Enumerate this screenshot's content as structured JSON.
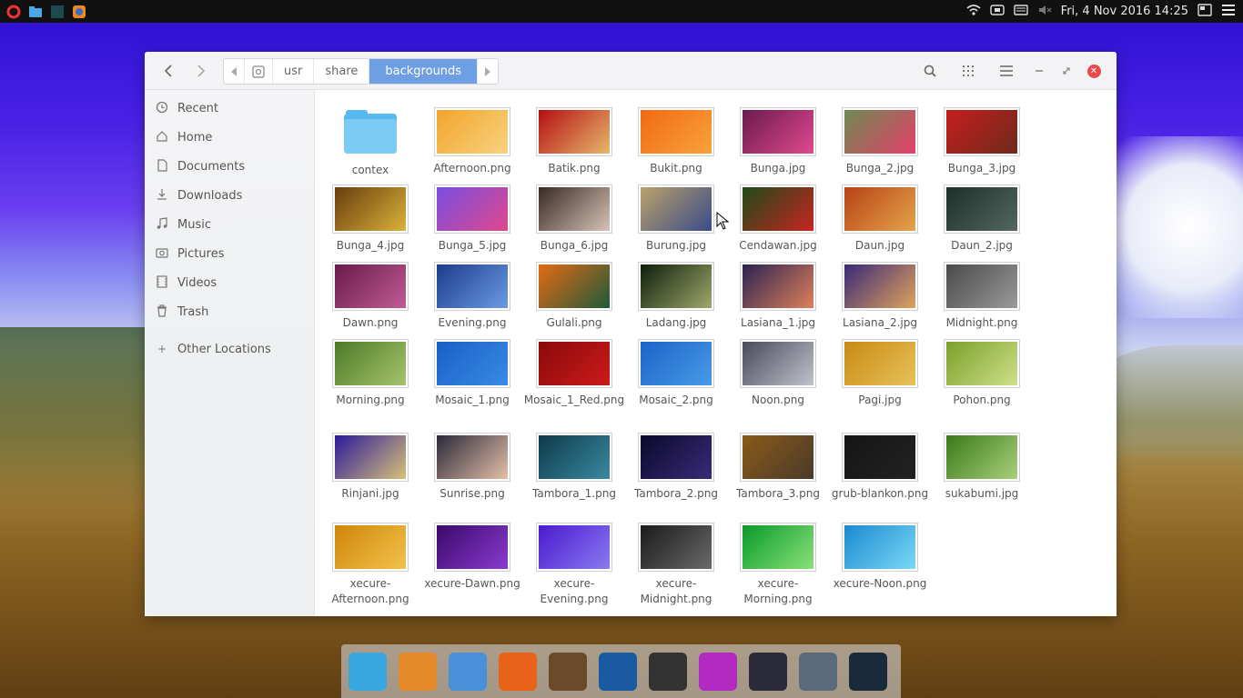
{
  "topbar": {
    "datetime": "Fri, 4 Nov 2016 14:25",
    "left_icons": [
      "opera-icon",
      "files-icon",
      "terminal-icon",
      "firefox-icon"
    ],
    "tray_icons": [
      "wifi-icon",
      "network-icon",
      "keyboard-icon",
      "volume-muted-icon"
    ]
  },
  "header": {
    "path": [
      "usr",
      "share",
      "backgrounds"
    ],
    "active_path": "backgrounds"
  },
  "sidebar": {
    "items": [
      {
        "label": "Recent",
        "icon": "clock-icon"
      },
      {
        "label": "Home",
        "icon": "home-icon"
      },
      {
        "label": "Documents",
        "icon": "document-icon"
      },
      {
        "label": "Downloads",
        "icon": "download-icon"
      },
      {
        "label": "Music",
        "icon": "music-icon"
      },
      {
        "label": "Pictures",
        "icon": "camera-icon"
      },
      {
        "label": "Videos",
        "icon": "film-icon"
      },
      {
        "label": "Trash",
        "icon": "trash-icon"
      }
    ],
    "other_locations": "Other Locations"
  },
  "files": [
    {
      "name": "contex",
      "type": "folder"
    },
    {
      "name": "Afternoon.png",
      "colors": [
        "#f2a42b",
        "#f7d380"
      ]
    },
    {
      "name": "Batik.png",
      "colors": [
        "#b50f14",
        "#e6b86a"
      ]
    },
    {
      "name": "Bukit.png",
      "colors": [
        "#f06a13",
        "#f9a23c"
      ]
    },
    {
      "name": "Bunga.jpg",
      "colors": [
        "#6b1a4f",
        "#e04a8e"
      ]
    },
    {
      "name": "Bunga_2.jpg",
      "colors": [
        "#6d8a52",
        "#e63f6a"
      ]
    },
    {
      "name": "Bunga_3.jpg",
      "colors": [
        "#c51e1e",
        "#6e2a1b"
      ]
    },
    {
      "name": "Bunga_4.jpg",
      "colors": [
        "#6a3d0e",
        "#d9b23a"
      ]
    },
    {
      "name": "Bunga_5.jpg",
      "colors": [
        "#7a4de0",
        "#e0488c"
      ]
    },
    {
      "name": "Bunga_6.jpg",
      "colors": [
        "#3a2a26",
        "#d6c3b5"
      ]
    },
    {
      "name": "Burung.jpg",
      "colors": [
        "#b8a26a",
        "#3a4b8a"
      ]
    },
    {
      "name": "Cendawan.jpg",
      "colors": [
        "#1e4a1a",
        "#c82520"
      ]
    },
    {
      "name": "Daun.jpg",
      "colors": [
        "#b84316",
        "#e3a34a"
      ]
    },
    {
      "name": "Daun_2.jpg",
      "colors": [
        "#1d2f2a",
        "#52675e"
      ]
    },
    {
      "name": "Dawn.png",
      "colors": [
        "#6a1a4a",
        "#c05c96"
      ]
    },
    {
      "name": "Evening.png",
      "colors": [
        "#1c3d8c",
        "#6a9ae2"
      ]
    },
    {
      "name": "Gulali.png",
      "colors": [
        "#e46a14",
        "#1e5a3a"
      ]
    },
    {
      "name": "Ladang.jpg",
      "colors": [
        "#0e1e0c",
        "#9fa86a"
      ]
    },
    {
      "name": "Lasiana_1.jpg",
      "colors": [
        "#2a2352",
        "#e0805a"
      ]
    },
    {
      "name": "Lasiana_2.jpg",
      "colors": [
        "#3a2a7a",
        "#e0a25a"
      ]
    },
    {
      "name": "Midnight.png",
      "colors": [
        "#4a4a4a",
        "#9a9a9a"
      ]
    },
    {
      "name": "Morning.png",
      "colors": [
        "#4c7a2a",
        "#a6c46a"
      ]
    },
    {
      "name": "Mosaic_1.png",
      "colors": [
        "#1860c4",
        "#3a8ae6"
      ]
    },
    {
      "name": "Mosaic_1_Red.png",
      "colors": [
        "#8a0a0a",
        "#cc1a1a"
      ]
    },
    {
      "name": "Mosaic_2.png",
      "colors": [
        "#1a64c8",
        "#4a9ae8"
      ]
    },
    {
      "name": "Noon.png",
      "colors": [
        "#4a4a5a",
        "#bfc2cc"
      ]
    },
    {
      "name": "Pagi.jpg",
      "colors": [
        "#c88a14",
        "#e6c25a"
      ]
    },
    {
      "name": "Pohon.png",
      "colors": [
        "#7aa02a",
        "#cfe08a"
      ]
    },
    {
      "name": "Rinjani.jpg",
      "colors": [
        "#2a1a9a",
        "#d8c07a"
      ]
    },
    {
      "name": "Sunrise.png",
      "colors": [
        "#2a2a3a",
        "#e6bfa8"
      ]
    },
    {
      "name": "Tambora_1.png",
      "colors": [
        "#0e3a4a",
        "#3a8aa0"
      ]
    },
    {
      "name": "Tambora_2.png",
      "colors": [
        "#0a0a2a",
        "#3a2a7a"
      ]
    },
    {
      "name": "Tambora_3.png",
      "colors": [
        "#8a5a1a",
        "#4a3a2a"
      ]
    },
    {
      "name": "grub-blankon.png",
      "colors": [
        "#151515",
        "#222222"
      ]
    },
    {
      "name": "sukabumi.jpg",
      "colors": [
        "#3a7a1a",
        "#a8d07a"
      ]
    },
    {
      "name": "xecure-Afternoon.png",
      "colors": [
        "#d0850a",
        "#f2c24a"
      ]
    },
    {
      "name": "xecure-Dawn.png",
      "colors": [
        "#3a0a6a",
        "#8a3ad0"
      ]
    },
    {
      "name": "xecure-Evening.png",
      "colors": [
        "#4a1ad0",
        "#8a7af0"
      ]
    },
    {
      "name": "xecure-Midnight.png",
      "colors": [
        "#1a1a1a",
        "#6a6a6a"
      ]
    },
    {
      "name": "xecure-Morning.png",
      "colors": [
        "#0a9a2a",
        "#8ae07a"
      ]
    },
    {
      "name": "xecure-Noon.png",
      "colors": [
        "#1a8ad0",
        "#7ad8f6"
      ]
    }
  ],
  "dock": {
    "apps": [
      {
        "name": "appstore-icon",
        "color": "#3aa8e0"
      },
      {
        "name": "calculator-icon",
        "color": "#e58a2a"
      },
      {
        "name": "file-manager-icon",
        "color": "#4a90d9"
      },
      {
        "name": "firefox-icon",
        "color": "#e8621a"
      },
      {
        "name": "gimp-icon",
        "color": "#6a4a2a"
      },
      {
        "name": "inkscape-icon",
        "color": "#1a5aa0"
      },
      {
        "name": "libreoffice-icon",
        "color": "#333333"
      },
      {
        "name": "chat-icon",
        "color": "#b22ac0"
      },
      {
        "name": "webcam-icon",
        "color": "#2a2a3a"
      },
      {
        "name": "settings-icon",
        "color": "#5a6a7a"
      },
      {
        "name": "terminal-icon",
        "color": "#1a2a3a"
      }
    ]
  }
}
